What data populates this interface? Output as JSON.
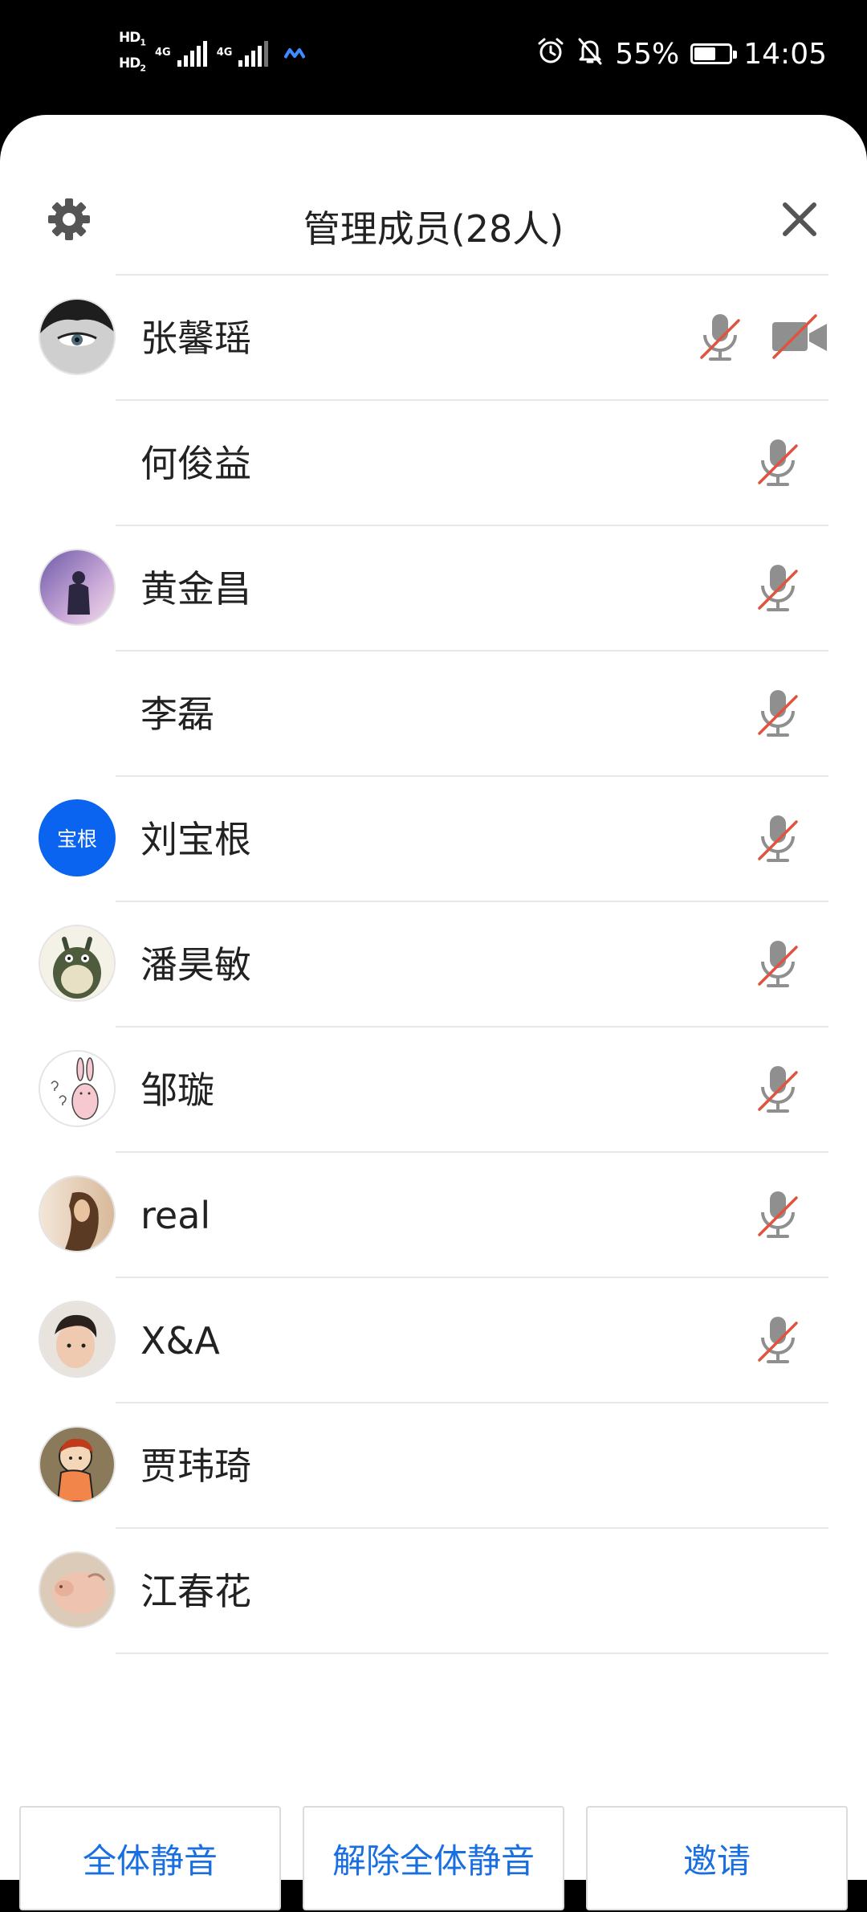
{
  "status_bar": {
    "hd1": "HD",
    "hd1_sub": "1",
    "hd2": "HD",
    "hd2_sub": "2",
    "net1": "4G",
    "net2": "4G",
    "battery_percent": "55%",
    "battery_level": 0.55,
    "time": "14:05",
    "icons": [
      "alarm-icon",
      "bell-off-icon",
      "battery-icon"
    ]
  },
  "header": {
    "title": "管理成员(28人)",
    "settings_icon": "gear-icon",
    "close_icon": "close-icon"
  },
  "members": [
    {
      "name": "张馨瑶",
      "avatar": "photo",
      "mic_muted": true,
      "camera_off": true
    },
    {
      "name": "何俊益",
      "avatar": "none",
      "mic_muted": true
    },
    {
      "name": "黄金昌",
      "avatar": "photo",
      "mic_muted": true
    },
    {
      "name": "李磊",
      "avatar": "none",
      "mic_muted": true
    },
    {
      "name": "刘宝根",
      "avatar_text": "宝根",
      "mic_muted": true
    },
    {
      "name": "潘昊敏",
      "avatar": "photo",
      "mic_muted": true
    },
    {
      "name": "邹璇",
      "avatar": "photo",
      "mic_muted": true
    },
    {
      "name": "real",
      "avatar": "photo",
      "mic_muted": true
    },
    {
      "name": "X&A",
      "avatar": "photo",
      "mic_muted": true
    },
    {
      "name": "贾玮琦",
      "avatar": "photo"
    },
    {
      "name": "江春花",
      "avatar": "photo"
    }
  ],
  "actions": {
    "mute_all": "全体静音",
    "unmute_all": "解除全体静音",
    "invite": "邀请"
  },
  "colors": {
    "accent": "#1a6fe0",
    "avatar_blue": "#0a64f0",
    "mute_slash": "#e0533f",
    "icon_gray": "#8f8f8f"
  }
}
